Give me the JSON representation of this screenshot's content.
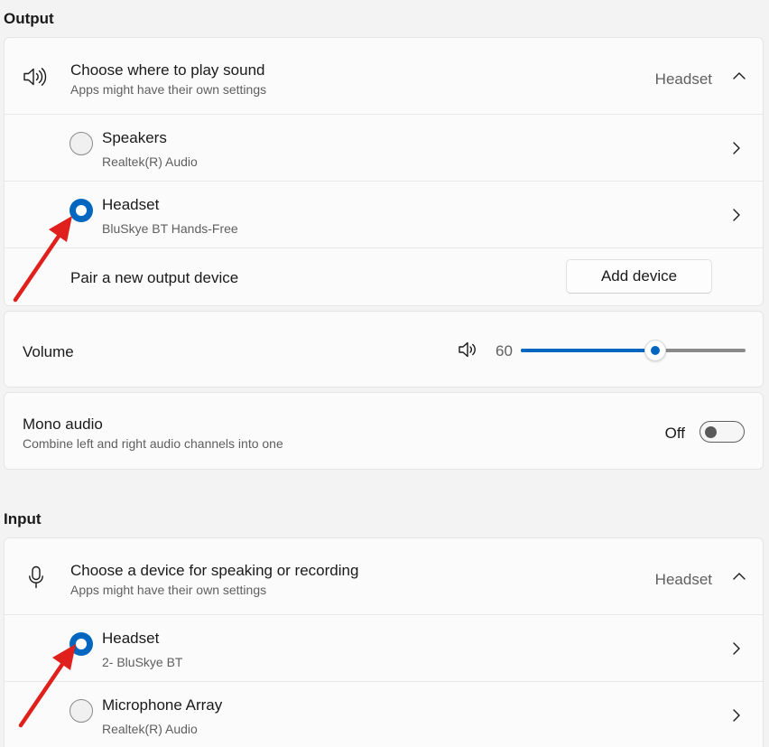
{
  "output": {
    "section_title": "Output",
    "header": {
      "title": "Choose where to play sound",
      "subtitle": "Apps might have their own settings",
      "selected": "Headset",
      "icon": "speaker-icon",
      "expanded": true
    },
    "devices": [
      {
        "name": "Speakers",
        "detail": "Realtek(R) Audio",
        "selected": false
      },
      {
        "name": "Headset",
        "detail": "BluSkye BT Hands-Free",
        "selected": true
      }
    ],
    "pair": {
      "label": "Pair a new output device",
      "button": "Add device"
    }
  },
  "volume": {
    "label": "Volume",
    "value": "60",
    "level": 0.6,
    "icon": "speaker-icon"
  },
  "mono": {
    "title": "Mono audio",
    "subtitle": "Combine left and right audio channels into one",
    "state": "Off"
  },
  "input": {
    "section_title": "Input",
    "header": {
      "title": "Choose a device for speaking or recording",
      "subtitle": "Apps might have their own settings",
      "selected": "Headset",
      "icon": "microphone-icon",
      "expanded": true
    },
    "devices": [
      {
        "name": "Headset",
        "detail": "2- BluSkye BT",
        "selected": true
      },
      {
        "name": "Microphone Array",
        "detail": "Realtek(R) Audio",
        "selected": false
      }
    ]
  },
  "annotation": {
    "arrow_color": "#e0201c"
  },
  "colors": {
    "accent": "#0067c0",
    "background": "#f3f3f3",
    "card": "#fbfbfb"
  }
}
